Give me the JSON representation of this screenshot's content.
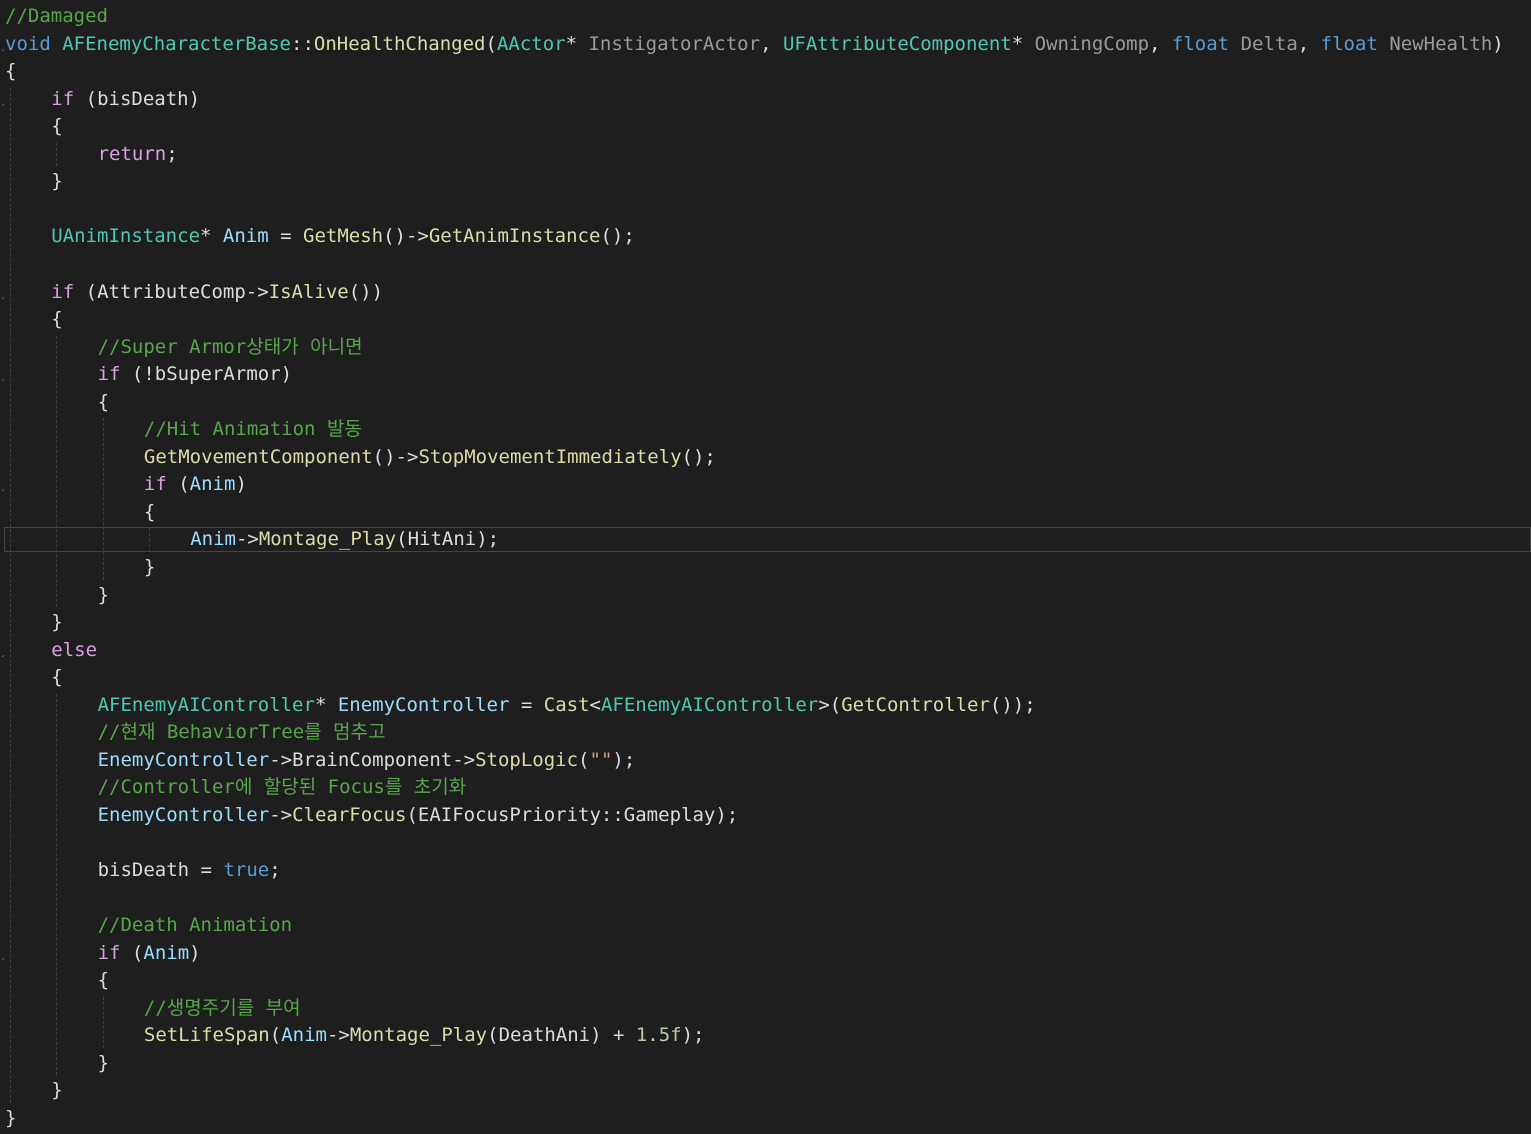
{
  "editor": {
    "theme_colors": {
      "background": "#1e1e1e",
      "comment": "#57a64a",
      "keyword": "#d8a0df",
      "type_keyword": "#569cd6",
      "class": "#4ec9b0",
      "function": "#dcdcaa",
      "variable": "#9cdcfe",
      "parameter": "#9a9a9a",
      "plain": "#dcdcdc",
      "number": "#b5cea8",
      "string": "#d69d85"
    },
    "current_line_index": 19,
    "lines": [
      {
        "indent": 0,
        "tokens": [
          [
            "comment",
            "//Damaged"
          ]
        ]
      },
      {
        "indent": 0,
        "fold": true,
        "tokens": [
          [
            "type",
            "void"
          ],
          [
            "plain",
            " "
          ],
          [
            "class",
            "AFEnemyCharacterBase"
          ],
          [
            "plain",
            "::"
          ],
          [
            "func",
            "OnHealthChanged"
          ],
          [
            "plain",
            "("
          ],
          [
            "class",
            "AActor"
          ],
          [
            "plain",
            "* "
          ],
          [
            "param",
            "InstigatorActor"
          ],
          [
            "plain",
            ", "
          ],
          [
            "class",
            "UFAttributeComponent"
          ],
          [
            "plain",
            "* "
          ],
          [
            "param",
            "OwningComp"
          ],
          [
            "plain",
            ", "
          ],
          [
            "type",
            "float"
          ],
          [
            "plain",
            " "
          ],
          [
            "param",
            "Delta"
          ],
          [
            "plain",
            ", "
          ],
          [
            "type",
            "float"
          ],
          [
            "plain",
            " "
          ],
          [
            "param",
            "NewHealth"
          ],
          [
            "plain",
            ")"
          ]
        ]
      },
      {
        "indent": 0,
        "tokens": [
          [
            "plain",
            "{"
          ]
        ]
      },
      {
        "indent": 1,
        "fold": true,
        "tokens": [
          [
            "ctrl",
            "if"
          ],
          [
            "plain",
            " (bisDeath)"
          ]
        ]
      },
      {
        "indent": 1,
        "tokens": [
          [
            "plain",
            "{"
          ]
        ]
      },
      {
        "indent": 2,
        "tokens": [
          [
            "ctrl",
            "return"
          ],
          [
            "plain",
            ";"
          ]
        ]
      },
      {
        "indent": 1,
        "tokens": [
          [
            "plain",
            "}"
          ]
        ]
      },
      {
        "indent": 0,
        "tokens": []
      },
      {
        "indent": 1,
        "tokens": [
          [
            "class",
            "UAnimInstance"
          ],
          [
            "plain",
            "* "
          ],
          [
            "var",
            "Anim"
          ],
          [
            "plain",
            " = "
          ],
          [
            "func",
            "GetMesh"
          ],
          [
            "plain",
            "()->"
          ],
          [
            "func",
            "GetAnimInstance"
          ],
          [
            "plain",
            "();"
          ]
        ]
      },
      {
        "indent": 0,
        "tokens": []
      },
      {
        "indent": 1,
        "fold": true,
        "tokens": [
          [
            "ctrl",
            "if"
          ],
          [
            "plain",
            " (AttributeComp->"
          ],
          [
            "func",
            "IsAlive"
          ],
          [
            "plain",
            "())"
          ]
        ]
      },
      {
        "indent": 1,
        "tokens": [
          [
            "plain",
            "{"
          ]
        ]
      },
      {
        "indent": 2,
        "tokens": [
          [
            "comment",
            "//Super Armor상태가 아니면"
          ]
        ]
      },
      {
        "indent": 2,
        "fold": true,
        "tokens": [
          [
            "ctrl",
            "if"
          ],
          [
            "plain",
            " (!bSuperArmor)"
          ]
        ]
      },
      {
        "indent": 2,
        "tokens": [
          [
            "plain",
            "{"
          ]
        ]
      },
      {
        "indent": 3,
        "tokens": [
          [
            "comment",
            "//Hit Animation 발동"
          ]
        ]
      },
      {
        "indent": 3,
        "tokens": [
          [
            "func",
            "GetMovementComponent"
          ],
          [
            "plain",
            "()->"
          ],
          [
            "func",
            "StopMovementImmediately"
          ],
          [
            "plain",
            "();"
          ]
        ]
      },
      {
        "indent": 3,
        "fold": true,
        "tokens": [
          [
            "ctrl",
            "if"
          ],
          [
            "plain",
            " ("
          ],
          [
            "var",
            "Anim"
          ],
          [
            "plain",
            ")"
          ]
        ]
      },
      {
        "indent": 3,
        "tokens": [
          [
            "plain",
            "{"
          ]
        ]
      },
      {
        "indent": 4,
        "tokens": [
          [
            "var",
            "Anim"
          ],
          [
            "plain",
            "->"
          ],
          [
            "func",
            "Montage_Play"
          ],
          [
            "plain",
            "(HitAni);"
          ]
        ]
      },
      {
        "indent": 3,
        "tokens": [
          [
            "plain",
            "}"
          ]
        ]
      },
      {
        "indent": 2,
        "tokens": [
          [
            "plain",
            "}"
          ]
        ]
      },
      {
        "indent": 1,
        "tokens": [
          [
            "plain",
            "}"
          ]
        ]
      },
      {
        "indent": 1,
        "fold": true,
        "tokens": [
          [
            "ctrl",
            "else"
          ]
        ]
      },
      {
        "indent": 1,
        "tokens": [
          [
            "plain",
            "{"
          ]
        ]
      },
      {
        "indent": 2,
        "tokens": [
          [
            "class",
            "AFEnemyAIController"
          ],
          [
            "plain",
            "* "
          ],
          [
            "var",
            "EnemyController"
          ],
          [
            "plain",
            " = "
          ],
          [
            "func",
            "Cast"
          ],
          [
            "plain",
            "<"
          ],
          [
            "class",
            "AFEnemyAIController"
          ],
          [
            "plain",
            ">("
          ],
          [
            "func",
            "GetController"
          ],
          [
            "plain",
            "());"
          ]
        ]
      },
      {
        "indent": 2,
        "tokens": [
          [
            "comment",
            "//현재 BehaviorTree를 멈추고"
          ]
        ]
      },
      {
        "indent": 2,
        "tokens": [
          [
            "var",
            "EnemyController"
          ],
          [
            "plain",
            "->BrainComponent->"
          ],
          [
            "func",
            "StopLogic"
          ],
          [
            "plain",
            "("
          ],
          [
            "string",
            "\"\""
          ],
          [
            "plain",
            ");"
          ]
        ]
      },
      {
        "indent": 2,
        "tokens": [
          [
            "comment",
            "//Controller에 할당된 Focus를 초기화"
          ]
        ]
      },
      {
        "indent": 2,
        "tokens": [
          [
            "var",
            "EnemyController"
          ],
          [
            "plain",
            "->"
          ],
          [
            "func",
            "ClearFocus"
          ],
          [
            "plain",
            "(EAIFocusPriority::Gameplay);"
          ]
        ]
      },
      {
        "indent": 0,
        "tokens": []
      },
      {
        "indent": 2,
        "tokens": [
          [
            "plain",
            "bisDeath = "
          ],
          [
            "bool",
            "true"
          ],
          [
            "plain",
            ";"
          ]
        ]
      },
      {
        "indent": 0,
        "tokens": []
      },
      {
        "indent": 2,
        "tokens": [
          [
            "comment",
            "//Death Animation"
          ]
        ]
      },
      {
        "indent": 2,
        "fold": true,
        "tokens": [
          [
            "ctrl",
            "if"
          ],
          [
            "plain",
            " ("
          ],
          [
            "var",
            "Anim"
          ],
          [
            "plain",
            ")"
          ]
        ]
      },
      {
        "indent": 2,
        "tokens": [
          [
            "plain",
            "{"
          ]
        ]
      },
      {
        "indent": 3,
        "tokens": [
          [
            "comment",
            "//생명주기를 부여"
          ]
        ]
      },
      {
        "indent": 3,
        "tokens": [
          [
            "func",
            "SetLifeSpan"
          ],
          [
            "plain",
            "("
          ],
          [
            "var",
            "Anim"
          ],
          [
            "plain",
            "->"
          ],
          [
            "func",
            "Montage_Play"
          ],
          [
            "plain",
            "(DeathAni) + "
          ],
          [
            "number",
            "1.5f"
          ],
          [
            "plain",
            ");"
          ]
        ]
      },
      {
        "indent": 2,
        "tokens": [
          [
            "plain",
            "}"
          ]
        ]
      },
      {
        "indent": 1,
        "tokens": [
          [
            "plain",
            "}"
          ]
        ]
      },
      {
        "indent": 0,
        "tokens": [
          [
            "plain",
            "}"
          ]
        ]
      }
    ]
  }
}
